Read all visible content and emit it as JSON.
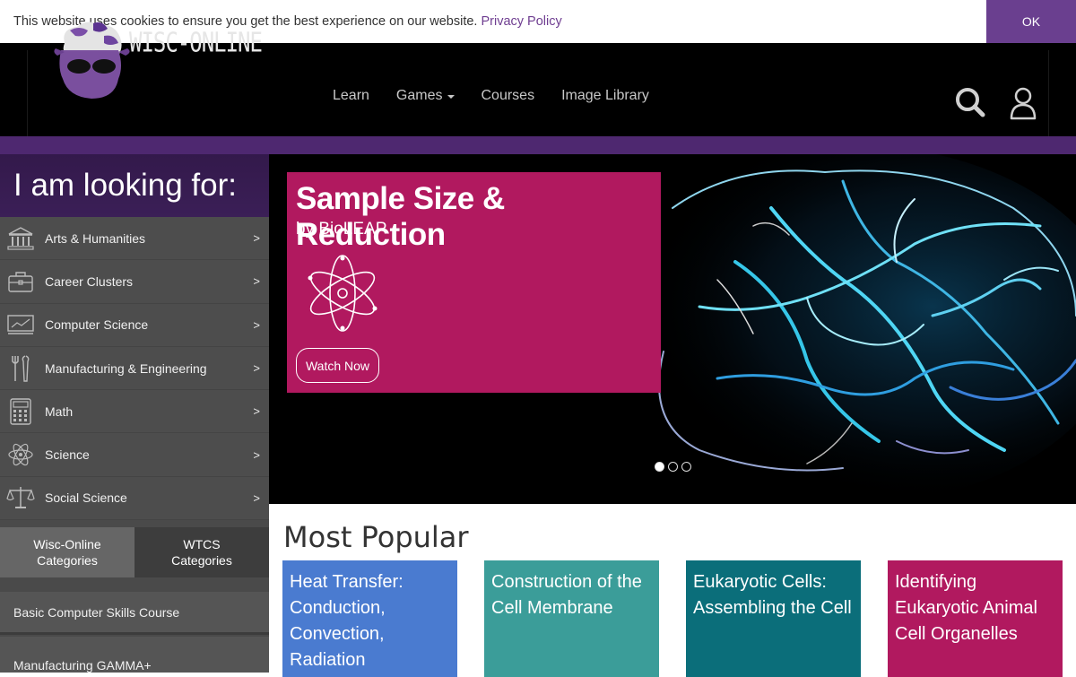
{
  "cookie": {
    "message": "This website uses cookies to ensure you get the best experience on our website.",
    "link": "Privacy Policy",
    "ok": "OK"
  },
  "header": {
    "logo_text": "WISC-ONLINE",
    "nav": [
      "Learn",
      "Games",
      "Courses",
      "Image Library"
    ]
  },
  "sidebar": {
    "title": "I am looking for:",
    "categories": [
      {
        "label": "Arts & Humanities",
        "icon": "museum-icon"
      },
      {
        "label": "Career Clusters",
        "icon": "briefcase-icon"
      },
      {
        "label": "Computer Science",
        "icon": "monitor-icon"
      },
      {
        "label": "Manufacturing & Engineering",
        "icon": "tools-icon"
      },
      {
        "label": "Math",
        "icon": "calculator-icon"
      },
      {
        "label": "Science",
        "icon": "atom-icon"
      },
      {
        "label": "Social Science",
        "icon": "scales-icon"
      }
    ],
    "arrow": ">",
    "tabs": [
      "Wisc-Online Categories",
      "WTCS Categories"
    ],
    "links": [
      "Basic Computer Skills Course",
      "Manufacturing GAMMA+"
    ]
  },
  "hero": {
    "title": "Sample Size & Reduction",
    "subtitle": "by BioLEAP",
    "button": "Watch Now",
    "slides": 3,
    "active_slide": 1
  },
  "popular": {
    "title": "Most Popular",
    "cards": [
      {
        "title": "Heat Transfer: Conduction, Convection, Radiation",
        "color": "#4a7bd0"
      },
      {
        "title": "Construction of the Cell Membrane",
        "color": "#3b9d99"
      },
      {
        "title": "Eukaryotic Cells: Assembling the Cell",
        "color": "#0b6e7a"
      },
      {
        "title": "Identifying Eukaryotic Animal Cell Organelles",
        "color": "#b1195f"
      }
    ]
  },
  "colors": {
    "brand_purple": "#6a3f8f",
    "hero_card": "#b1195f",
    "sidebar_bg": "#4d4d4d"
  }
}
